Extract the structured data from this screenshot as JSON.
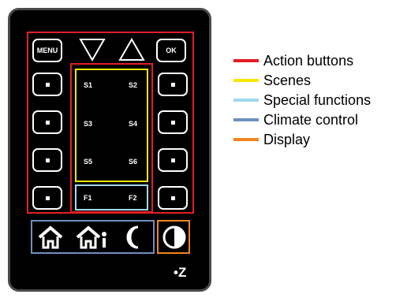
{
  "device": {
    "menu_label": "MENU",
    "ok_label": "OK",
    "scenes": [
      "S1",
      "S2",
      "S3",
      "S4",
      "S5",
      "S6"
    ],
    "functions": [
      "F1",
      "F2"
    ],
    "logo_text": "•Z",
    "icons": {
      "down": "triangle-down-icon",
      "up": "triangle-up-icon",
      "home": "house-icon",
      "away": "house-person-icon",
      "night": "moon-icon",
      "display": "half-circle-icon"
    }
  },
  "legend": [
    {
      "label": "Action buttons",
      "color": "#e31e24"
    },
    {
      "label": "Scenes",
      "color": "#f5e800"
    },
    {
      "label": "Special functions",
      "color": "#9fd9ee"
    },
    {
      "label": "Climate control",
      "color": "#6f8fbf"
    },
    {
      "label": "Display",
      "color": "#f28422"
    }
  ]
}
